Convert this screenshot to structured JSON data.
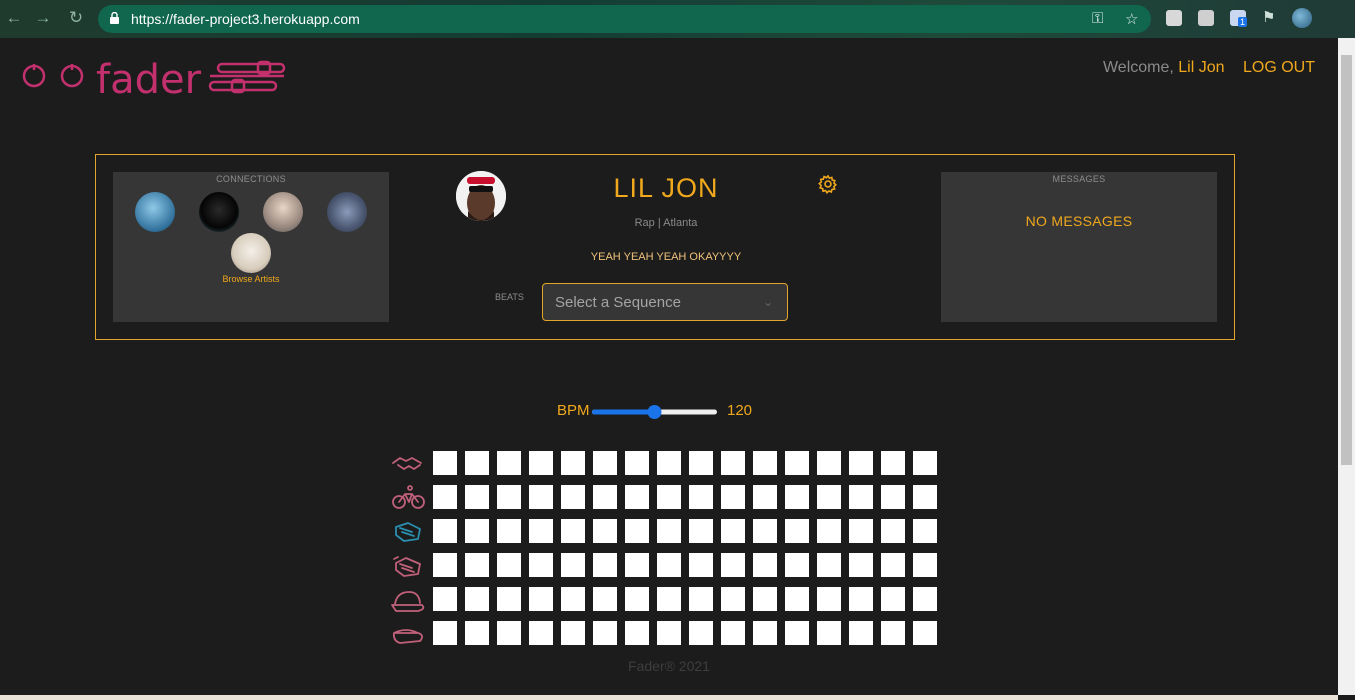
{
  "browser": {
    "url": "https://fader-project3.herokuapp.com",
    "extension_badge": "1"
  },
  "header": {
    "logo_text": "fader",
    "welcome_prefix": "Welcome,",
    "user_name": "Lil Jon",
    "logout_label": "LOG OUT"
  },
  "connections": {
    "title": "CONNECTIONS",
    "browse_label": "Browse Artists",
    "avatars": [
      "connection-avatar-1",
      "connection-avatar-2",
      "connection-avatar-3",
      "connection-avatar-4",
      "connection-avatar-5"
    ]
  },
  "profile": {
    "name": "LIL JON",
    "subtitle": "Rap | Atlanta",
    "quote": "YEAH YEAH YEAH OKAYYYY",
    "beats_label": "BEATS",
    "sequence_placeholder": "Select a Sequence"
  },
  "messages": {
    "title": "MESSAGES",
    "empty_text": "NO MESSAGES"
  },
  "sequencer": {
    "bpm_label": "BPM",
    "bpm_value": "120",
    "bpm_min": 60,
    "bpm_max": 180,
    "bpm_fraction": 0.5,
    "steps": 16,
    "tracks": [
      {
        "icon": "handshake-icon",
        "color": "#c0607a"
      },
      {
        "icon": "bicycle-icon",
        "color": "#c0607a"
      },
      {
        "icon": "clap-icon",
        "color": "#2a8fb0"
      },
      {
        "icon": "clap-hands-icon",
        "color": "#c0607a"
      },
      {
        "icon": "cap-icon",
        "color": "#c0607a"
      },
      {
        "icon": "visor-icon",
        "color": "#c0607a"
      }
    ]
  },
  "footer": {
    "text": "Fader® 2021"
  },
  "colors": {
    "accent": "#f0a81d",
    "logo": "#c2306d",
    "background": "#1c1c1c",
    "panel": "#363636"
  }
}
